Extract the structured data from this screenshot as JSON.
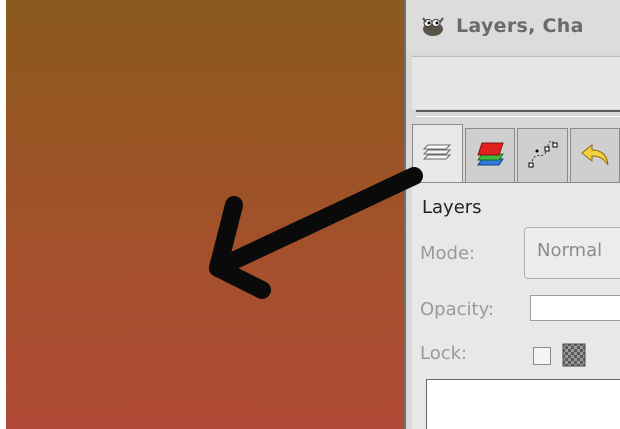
{
  "window": {
    "title": "Layers, Cha"
  },
  "tabs": [
    {
      "name": "layers",
      "icon": "layers-icon"
    },
    {
      "name": "channels",
      "icon": "channels-icon"
    },
    {
      "name": "paths",
      "icon": "paths-icon"
    },
    {
      "name": "undo-history",
      "icon": "undo-icon"
    }
  ],
  "panel": {
    "title": "Layers",
    "mode_label": "Mode:",
    "mode_value": "Normal",
    "opacity_label": "Opacity:",
    "lock_label": "Lock:"
  },
  "colors": {
    "desktop_top": "#8a5a1e",
    "desktop_bottom": "#b04a36",
    "arrow": "#0a0a0a"
  }
}
